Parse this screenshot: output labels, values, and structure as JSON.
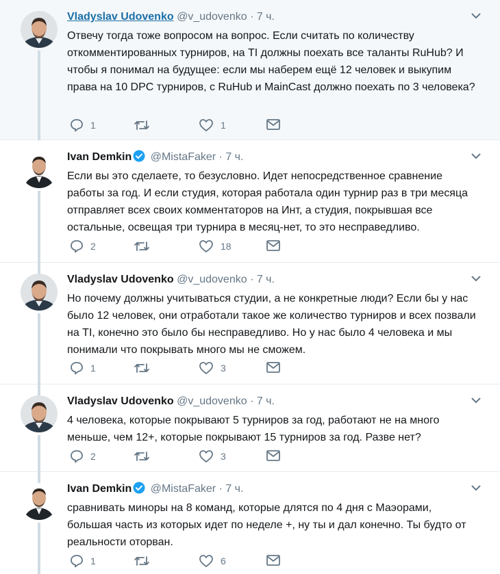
{
  "tweets": [
    {
      "name": "Vladyslav Udovenko",
      "handle": "@v_udovenko",
      "time": "· 7 ч.",
      "verified": false,
      "text": "Отвечу тогда тоже вопросом на вопрос. Если считать по количеству откомментированных турниров, на TI должны поехать все таланты RuHub? И чтобы я понимал на будущее: если мы наберем ещё 12 человек и выкупим права на 10 DPC турниров, с RuHub и MainCast должно поехать по 3 человека?",
      "replies": "1",
      "retweets": "",
      "likes": "1"
    },
    {
      "name": "Ivan Demkin",
      "handle": "@MistaFaker",
      "time": "· 7 ч.",
      "verified": true,
      "text": "Если вы это сделаете, то безусловно. Идет непосредственное сравнение работы за год. И если студия, которая работала один турнир раз в три месяца отправляет всех своих комментаторов на Инт, а студия, покрывшая все остальные, освещая три турнира в месяц-нет, то это несправедливо.",
      "replies": "2",
      "retweets": "",
      "likes": "18"
    },
    {
      "name": "Vladyslav Udovenko",
      "handle": "@v_udovenko",
      "time": "· 7 ч.",
      "verified": false,
      "text": "Но почему должны учитываться студии, а не конкретные люди? Если бы у нас было 12 человек, они отработали такое же количество турниров и всех позвали на TI, конечно это было бы несправедливо. Но у нас было 4 человека и мы понимали что покрывать много мы не сможем.",
      "replies": "1",
      "retweets": "",
      "likes": "3"
    },
    {
      "name": "Vladyslav Udovenko",
      "handle": "@v_udovenko",
      "time": "· 7 ч.",
      "verified": false,
      "text": "4 человека, которые покрывают 5 турниров за год, работают не на много меньше, чем 12+, которые покрывают 15 турниров за год. Разве нет?",
      "replies": "2",
      "retweets": "",
      "likes": "3"
    },
    {
      "name": "Ivan Demkin",
      "handle": "@MistaFaker",
      "time": "· 7 ч.",
      "verified": true,
      "text": "сравнивать миноры на 8 команд, которые длятся по 4 дня с Маэорами, большая часть из которых идет по неделе +, ну ты и дал конечно. Ты будто от реальности оторван.",
      "replies": "1",
      "retweets": "",
      "likes": "6"
    }
  ]
}
